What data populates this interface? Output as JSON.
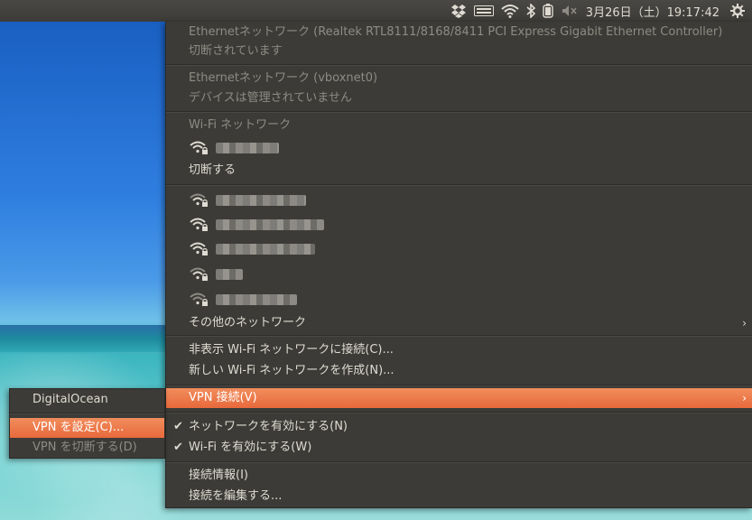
{
  "panel": {
    "clock": "3月26日（土）19:17:42",
    "indicators": [
      "dropbox-icon",
      "keyboard-icon",
      "wifi-icon",
      "bluetooth-icon",
      "battery-icon",
      "volume-muted-icon",
      "gear-icon"
    ]
  },
  "menu": {
    "ethernet1_title": "Ethernetネットワーク (Realtek RTL8111/8168/8411 PCI Express Gigabit Ethernet Controller)",
    "ethernet1_status": "切断されています",
    "ethernet2_title": "Ethernetネットワーク (vboxnet0)",
    "ethernet2_status": "デバイスは管理されていません",
    "wifi_header": "Wi-Fi ネットワーク",
    "disconnect": "切断する",
    "other_networks": "その他のネットワーク",
    "connect_hidden": "非表示 Wi-Fi ネットワークに接続(C)...",
    "create_new": "新しい Wi-Fi ネットワークを作成(N)...",
    "vpn_connections": "VPN 接続(V)",
    "enable_networking": "ネットワークを有効にする(N)",
    "enable_wifi": "Wi-Fi を有効にする(W)",
    "connection_info": "接続情報(I)",
    "edit_connections": "接続を編集する...",
    "check_mark": "✔",
    "arrow": "›"
  },
  "vpn_submenu": {
    "digitalocean": "DigitalOcean",
    "configure": "VPN を設定(C)...",
    "disconnect": "VPN を切断する(D)"
  },
  "colors": {
    "accent": "#e9683b",
    "menu_bg": "#3c3b37",
    "text": "#dfdbd2",
    "dim_text": "#8e8b84"
  }
}
